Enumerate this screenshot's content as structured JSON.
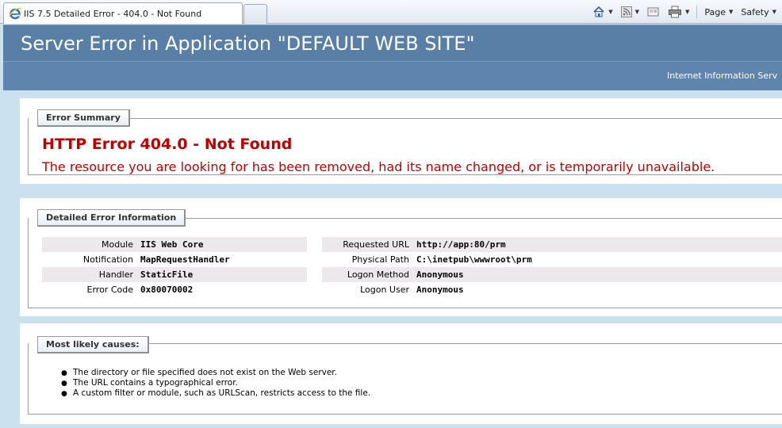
{
  "browser": {
    "tab_title": "IIS 7.5 Detailed Error - 404.0 - Not Found",
    "commands": {
      "page_label": "Page",
      "safety_label": "Safety"
    },
    "icons": [
      "ie-logo-icon",
      "home-icon",
      "rss-feed-icon",
      "read-mail-icon",
      "print-icon"
    ]
  },
  "header": {
    "title": "Server Error in Application \"DEFAULT WEB SITE\"",
    "subtitle": "Internet Information Serv"
  },
  "error_summary": {
    "legend": "Error Summary",
    "title": "HTTP Error 404.0 - Not Found",
    "message": "The resource you are looking for has been removed, had its name changed, or is temporarily unavailable."
  },
  "detailed_info": {
    "legend": "Detailed Error Information",
    "left": [
      {
        "label": "Module",
        "value": "IIS Web Core"
      },
      {
        "label": "Notification",
        "value": "MapRequestHandler"
      },
      {
        "label": "Handler",
        "value": "StaticFile"
      },
      {
        "label": "Error Code",
        "value": "0x80070002"
      }
    ],
    "right": [
      {
        "label": "Requested URL",
        "value": "http://app:80/prm"
      },
      {
        "label": "Physical Path",
        "value": "C:\\inetpub\\wwwroot\\prm"
      },
      {
        "label": "Logon Method",
        "value": "Anonymous"
      },
      {
        "label": "Logon User",
        "value": "Anonymous"
      }
    ]
  },
  "causes": {
    "legend": "Most likely causes:",
    "items": [
      "The directory or file specified does not exist on the Web server.",
      "The URL contains a typographical error.",
      "A custom filter or module, such as URLScan, restricts access to the file."
    ]
  },
  "colors": {
    "header_bg": "#5a7fa7",
    "page_bg": "#cbe1ef",
    "error_red": "#c00000",
    "row_shade": "#ece8ec"
  }
}
